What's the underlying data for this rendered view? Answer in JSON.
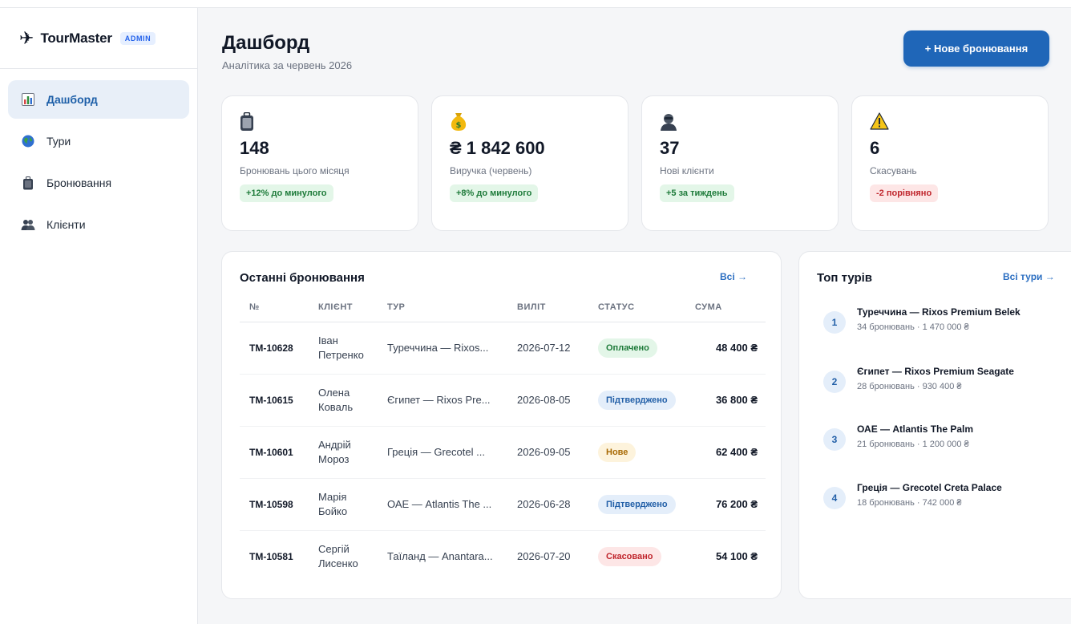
{
  "brand": {
    "name": "TourMaster",
    "badge": "ADMIN"
  },
  "nav": [
    {
      "label": "Дашборд",
      "icon": "bar-chart-icon",
      "active": true
    },
    {
      "label": "Тури",
      "icon": "globe-icon",
      "active": false
    },
    {
      "label": "Бронювання",
      "icon": "luggage-icon",
      "active": false
    },
    {
      "label": "Клієнти",
      "icon": "users-icon",
      "active": false
    }
  ],
  "header": {
    "title": "Дашборд",
    "subtitle": "Аналітика за червень 2026",
    "new_booking_label": "+ Нове бронювання"
  },
  "stats": [
    {
      "icon": "luggage-icon",
      "value": "148",
      "label": "Бронювань цього місяця",
      "badge": "+12% до минулого",
      "trend": "up"
    },
    {
      "icon": "money-bag-icon",
      "value": "₴ 1 842 600",
      "label": "Виручка (червень)",
      "badge": "+8% до минулого",
      "trend": "up"
    },
    {
      "icon": "person-icon",
      "value": "37",
      "label": "Нові клієнти",
      "badge": "+5 за тиждень",
      "trend": "up"
    },
    {
      "icon": "warning-icon",
      "value": "6",
      "label": "Скасувань",
      "badge": "-2 порівняно",
      "trend": "down"
    }
  ],
  "bookings": {
    "title": "Останні бронювання",
    "link": "Всі →",
    "columns": [
      "№",
      "КЛІЄНТ",
      "ТУР",
      "ВИЛІТ",
      "СТАТУС",
      "СУМА"
    ],
    "rows": [
      {
        "id": "TM-10628",
        "client_first": "Іван",
        "client_last": "Петренко",
        "tour": "Туреччина — Rixos...",
        "date": "2026-07-12",
        "status": "Оплачено",
        "status_kind": "paid",
        "sum": "48 400 ₴"
      },
      {
        "id": "TM-10615",
        "client_first": "Олена",
        "client_last": "Коваль",
        "tour": "Єгипет — Rixos Pre...",
        "date": "2026-08-05",
        "status": "Підтверджено",
        "status_kind": "confirmed",
        "sum": "36 800 ₴"
      },
      {
        "id": "TM-10601",
        "client_first": "Андрій",
        "client_last": "Мороз",
        "tour": "Греція — Grecotel ...",
        "date": "2026-09-05",
        "status": "Нове",
        "status_kind": "new",
        "sum": "62 400 ₴"
      },
      {
        "id": "TM-10598",
        "client_first": "Марія",
        "client_last": "Бойко",
        "tour": "ОАЕ — Atlantis The ...",
        "date": "2026-06-28",
        "status": "Підтверджено",
        "status_kind": "confirmed",
        "sum": "76 200 ₴"
      },
      {
        "id": "TM-10581",
        "client_first": "Сергій",
        "client_last": "Лисенко",
        "tour": "Таїланд — Anantara...",
        "date": "2026-07-20",
        "status": "Скасовано",
        "status_kind": "cancel",
        "sum": "54 100 ₴"
      }
    ]
  },
  "top_tours": {
    "title": "Топ турів",
    "link": "Всі тури →",
    "items": [
      {
        "rank": "1",
        "name": "Туреччина — Rixos Premium Belek",
        "meta": "34 бронювань · 1 470 000 ₴"
      },
      {
        "rank": "2",
        "name": "Єгипет — Rixos Premium Seagate",
        "meta": "28 бронювань · 930 400 ₴"
      },
      {
        "rank": "3",
        "name": "ОАЕ — Atlantis The Palm",
        "meta": "21 бронювань · 1 200 000 ₴"
      },
      {
        "rank": "4",
        "name": "Греція — Grecotel Creta Palace",
        "meta": "18 бронювань · 742 000 ₴"
      }
    ]
  }
}
